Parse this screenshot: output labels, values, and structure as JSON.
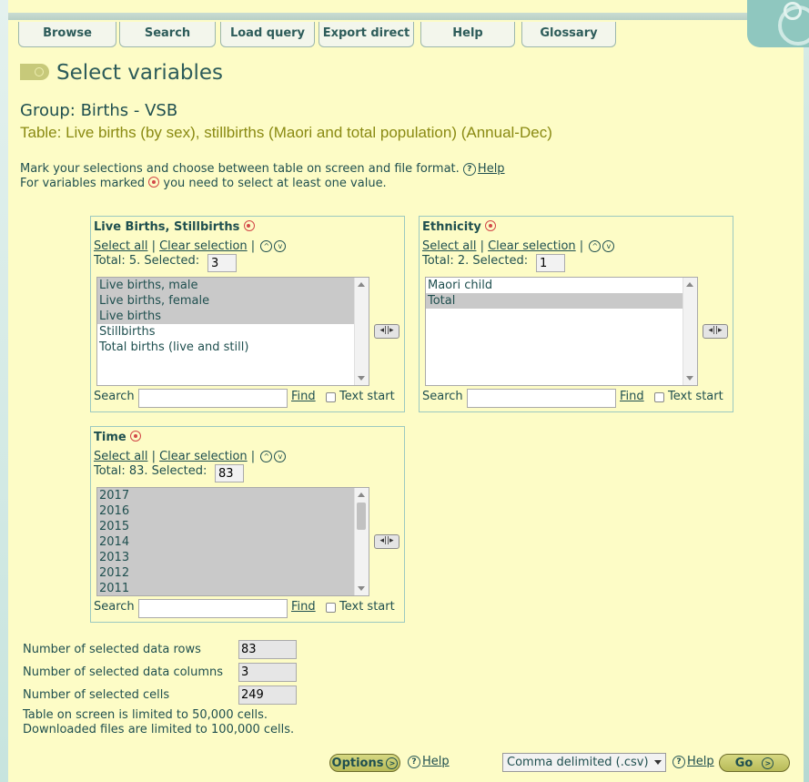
{
  "nav": {
    "tabs": [
      {
        "label": "Browse"
      },
      {
        "label": "Search"
      },
      {
        "label": "Load query"
      },
      {
        "label": "Export direct"
      },
      {
        "label": "Help"
      },
      {
        "label": "Glossary"
      }
    ]
  },
  "page": {
    "title": "Select variables",
    "group": "Group: Births - VSB",
    "table": "Table: Live births (by sex), stillbirths (Maori and total population) (Annual-Dec)",
    "instruction_1": "Mark your selections and choose between table on screen and file format.",
    "instruction_help": "Help",
    "instruction_2a": "For variables marked",
    "instruction_2b": "you need to select at least one value."
  },
  "common": {
    "select_all": "Select all",
    "clear_selection": "Clear selection",
    "search_label": "Search",
    "find_label": "Find",
    "text_start_label": "Text start"
  },
  "variables": [
    {
      "title": "Live Births, Stillbirths",
      "total_text": "Total: 5. Selected:",
      "selected": "3",
      "items": [
        {
          "label": "Live births, male",
          "selected": true
        },
        {
          "label": "Live births, female",
          "selected": true
        },
        {
          "label": "Live births",
          "selected": true
        },
        {
          "label": "Stillbirths",
          "selected": false
        },
        {
          "label": "Total births (live and still)",
          "selected": false
        }
      ]
    },
    {
      "title": "Ethnicity",
      "total_text": "Total: 2. Selected:",
      "selected": "1",
      "items": [
        {
          "label": "Maori child",
          "selected": false
        },
        {
          "label": "Total",
          "selected": true
        }
      ]
    },
    {
      "title": "Time",
      "total_text": "Total: 83. Selected:",
      "selected": "83",
      "items": [
        {
          "label": "2017",
          "selected": true
        },
        {
          "label": "2016",
          "selected": true
        },
        {
          "label": "2015",
          "selected": true
        },
        {
          "label": "2014",
          "selected": true
        },
        {
          "label": "2013",
          "selected": true
        },
        {
          "label": "2012",
          "selected": true
        },
        {
          "label": "2011",
          "selected": true
        }
      ]
    }
  ],
  "stats": {
    "rows_label": "Number of selected data rows",
    "rows_value": "83",
    "cols_label": "Number of selected data columns",
    "cols_value": "3",
    "cells_label": "Number of selected cells",
    "cells_value": "249",
    "limit_screen": "Table on screen is limited to 50,000 cells.",
    "limit_download": "Downloaded files are limited to 100,000 cells."
  },
  "controls": {
    "options_label": "Options",
    "help_label": "Help",
    "format_value": "Comma delimited (.csv)",
    "go_label": "Go"
  },
  "colors": {
    "background": "#fdfcc6",
    "accent_teal": "#2d5c5a",
    "table_title": "#8a8a12",
    "required_marker": "#d24848"
  }
}
